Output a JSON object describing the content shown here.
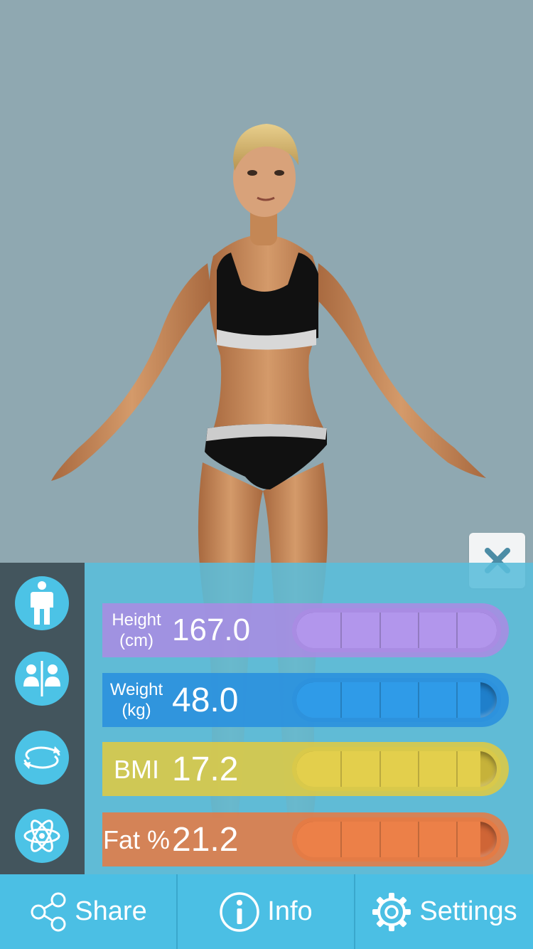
{
  "colors": {
    "background": "#8fa8b1",
    "sidebar": "#43555d",
    "panel": "#5abddb",
    "tabbar": "#4bbfe4",
    "height_accent": "#a98ce3",
    "weight_accent": "#2d92dd",
    "bmi_accent": "#d9c94a",
    "fat_accent": "#e47b45"
  },
  "close": {
    "icon": "close-icon"
  },
  "sidebar": {
    "buttons": [
      {
        "icon": "person-icon",
        "active": true
      },
      {
        "icon": "compare-people-icon",
        "active": false
      },
      {
        "icon": "rotate-icon",
        "active": false
      },
      {
        "icon": "atom-icon",
        "active": false
      }
    ]
  },
  "measurements": [
    {
      "label": "Height\n(cm)",
      "value": "167.0",
      "level": 1.0
    },
    {
      "label": "Weight\n(kg)",
      "value": "48.0",
      "level": 0.92
    },
    {
      "label": "BMI",
      "value": "17.2",
      "level": 0.92
    },
    {
      "label": "Fat %",
      "value": "21.2",
      "level": 0.92
    }
  ],
  "tabs": {
    "share": {
      "label": "Share",
      "icon": "share-icon"
    },
    "info": {
      "label": "Info",
      "icon": "info-icon"
    },
    "settings": {
      "label": "Settings",
      "icon": "gear-icon"
    }
  }
}
